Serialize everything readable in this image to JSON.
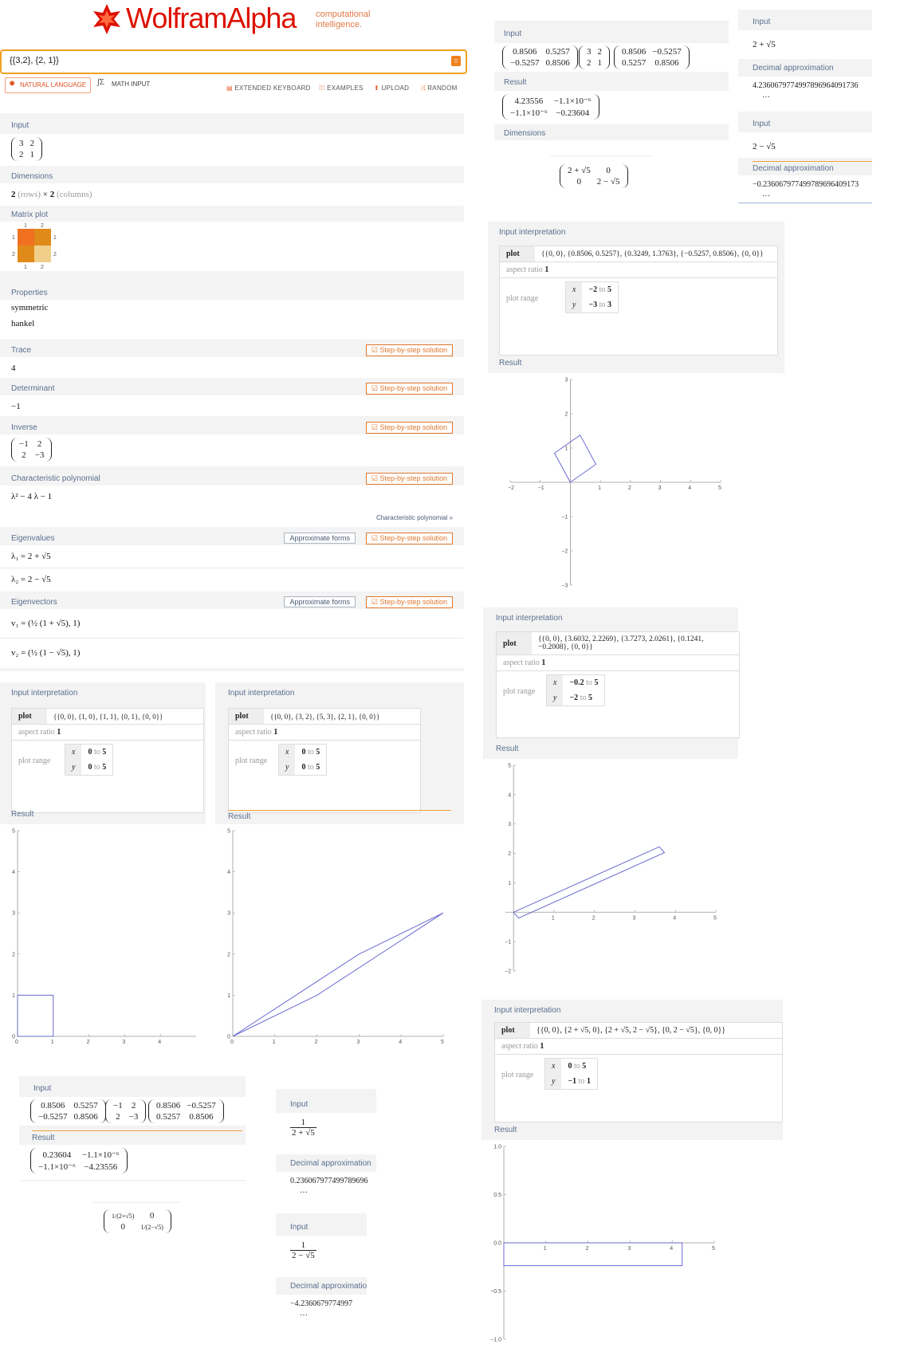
{
  "header": {
    "logo_word": "WolframAlpha",
    "tagline_1": "computational",
    "tagline_2": "intelligence.",
    "query": "{{3,2}, {2, 1}}",
    "natural_language": "NATURAL LANGUAGE",
    "math_input": "MATH INPUT",
    "extended_keyboard": "EXTENDED KEYBOARD",
    "examples": "EXAMPLES",
    "upload": "UPLOAD",
    "random": "RANDOM"
  },
  "main": {
    "input_label": "Input",
    "matrix": [
      [
        "3",
        "2"
      ],
      [
        "2",
        "1"
      ]
    ],
    "dimensions_label": "Dimensions",
    "dimensions_rows": "2",
    "dimensions_rows_word": "(rows)",
    "dimensions_times": "×",
    "dimensions_cols": "2",
    "dimensions_cols_word": "(columns)",
    "matrix_plot_label": "Matrix plot",
    "matrix_plot_ticks": [
      "1",
      "2"
    ],
    "properties_label": "Properties",
    "properties": [
      "symmetric",
      "hankel"
    ],
    "trace_label": "Trace",
    "trace": "4",
    "determinant_label": "Determinant",
    "determinant": "−1",
    "inverse_label": "Inverse",
    "inverse": [
      [
        "−1",
        "2"
      ],
      [
        "2",
        "−3"
      ]
    ],
    "char_poly_label": "Characteristic polynomial",
    "char_poly": "λ² − 4 λ − 1",
    "char_poly_link": "Characteristic polynomial »",
    "eigenvalues_label": "Eigenvalues",
    "eigenvalue_1": "λ₁ = 2 + √5",
    "eigenvalue_2": "λ₂ = 2 − √5",
    "eigenvectors_label": "Eigenvectors",
    "eigenvector_1": "v₁ = (½ (1 + √5), 1)",
    "eigenvector_2": "v₂ = (½ (1 − √5), 1)",
    "step_by_step": "Step-by-step solution",
    "approximate_forms": "Approximate forms"
  },
  "diag_panel": {
    "input_label": "Input",
    "m1": [
      [
        "0.8506",
        "0.5257"
      ],
      [
        "−0.5257",
        "0.8506"
      ]
    ],
    "m2": [
      [
        "3",
        "2"
      ],
      [
        "2",
        "1"
      ]
    ],
    "m3": [
      [
        "0.8506",
        "−0.5257"
      ],
      [
        "0.5257",
        "0.8506"
      ]
    ],
    "result_label": "Result",
    "result": [
      [
        "4.23556",
        "−1.1×10⁻⁶"
      ],
      [
        "−1.1×10⁻⁶",
        "−0.23604"
      ]
    ],
    "dimensions_label": "Dimensions",
    "diag": [
      [
        "2 + √5",
        "0"
      ],
      [
        "0",
        "2 − √5"
      ]
    ]
  },
  "eig_values_panel": {
    "input_label": "Input",
    "input_1": "2 + √5",
    "decimal_label": "Decimal approximation",
    "decimal_1": "4.2360679774997896964091736",
    "input_2": "2 − √5",
    "decimal_2": "−0.236067977499789696409173",
    "ellipsis": "…"
  },
  "plots": {
    "input_interpretation": "Input interpretation",
    "plot_word": "plot",
    "aspect_ratio_word": "aspect ratio",
    "aspect_ratio_value": "1",
    "plot_range_word": "plot range",
    "to_word": "to",
    "result_label": "Result",
    "p1": {
      "points": "{{0, 0}, {0.8506, 0.5257}, {0.3249, 1.3763}, {−0.5257, 0.8506}, {0, 0}}",
      "xmin": "−2",
      "xmax": "5",
      "ymin": "−3",
      "ymax": "3"
    },
    "p2": {
      "points": "{{0, 0}, {3.6032, 2.2269}, {3.7273, 2.0261}, {0.1241, −0.2008}, {0, 0}}",
      "xmin": "−0.2",
      "xmax": "5",
      "ymin": "−2",
      "ymax": "5"
    },
    "p3": {
      "points": "{{0, 0}, {1, 0}, {1, 1}, {0, 1}, {0, 0}}",
      "xmin": "0",
      "xmax": "5",
      "ymin": "0",
      "ymax": "5"
    },
    "p4": {
      "points": "{{0, 0}, {3, 2}, {5, 3}, {2, 1}, {0, 0}}",
      "xmin": "0",
      "xmax": "5",
      "ymin": "0",
      "ymax": "5"
    },
    "p5": {
      "points": "{{0, 0}, {2 + √5, 0}, {2 + √5, 2 − √5}, {0, 2 − √5}, {0, 0}}",
      "xmin": "0",
      "xmax": "5",
      "ymin": "−1",
      "ymax": "1"
    }
  },
  "inv_panel": {
    "input_label": "Input",
    "m1": [
      [
        "0.8506",
        "0.5257"
      ],
      [
        "−0.5257",
        "0.8506"
      ]
    ],
    "m2": [
      [
        "−1",
        "2"
      ],
      [
        "2",
        "−3"
      ]
    ],
    "m3": [
      [
        "0.8506",
        "−0.5257"
      ],
      [
        "0.5257",
        "0.8506"
      ]
    ],
    "result_label": "Result",
    "result": [
      [
        "0.23604",
        "−1.1×10⁻⁶"
      ],
      [
        "−1.1×10⁻⁶",
        "−4.23556"
      ]
    ],
    "diag": [
      [
        "1/(2+√5)",
        "0"
      ],
      [
        "0",
        "1/(2−√5)"
      ]
    ]
  },
  "recip_panels": {
    "input_label": "Input",
    "decimal_label": "Decimal approximation",
    "r1_num": "1",
    "r1_den": "2 + √5",
    "r1_decimal": "0.236067977499789696",
    "r2_num": "1",
    "r2_den": "2 − √5",
    "r2_decimal": "−4.2360679774997",
    "ellipsis": "…"
  },
  "chart_data": [
    {
      "type": "line",
      "series": [
        {
          "x": [
            0,
            0.8506,
            0.3249,
            -0.5257,
            0
          ],
          "y": [
            0,
            0.5257,
            1.3763,
            0.8506,
            0
          ]
        }
      ],
      "xlim": [
        -2,
        5
      ],
      "ylim": [
        -3,
        3
      ],
      "xticks": [
        "−2",
        "−1",
        "1",
        "2",
        "3",
        "4",
        "5"
      ],
      "yticks": [
        "3",
        "2",
        "1",
        "−1",
        "−2",
        "−3"
      ]
    },
    {
      "type": "line",
      "series": [
        {
          "x": [
            0,
            3.6032,
            3.7273,
            0.1241,
            0
          ],
          "y": [
            0,
            2.2269,
            2.0261,
            -0.2008,
            0
          ]
        }
      ],
      "xlim": [
        -0.2,
        5
      ],
      "ylim": [
        -2,
        5
      ],
      "xticks": [
        "1",
        "2",
        "3",
        "4",
        "5"
      ],
      "yticks": [
        "5",
        "4",
        "3",
        "2",
        "1",
        "−1",
        "−2"
      ]
    },
    {
      "type": "line",
      "series": [
        {
          "x": [
            0,
            1,
            1,
            0,
            0
          ],
          "y": [
            0,
            0,
            1,
            1,
            0
          ]
        }
      ],
      "xlim": [
        0,
        5
      ],
      "ylim": [
        0,
        5
      ],
      "xticks": [
        "0",
        "1",
        "2",
        "3",
        "4"
      ],
      "yticks": [
        "5",
        "4",
        "3",
        "2",
        "1",
        "0"
      ]
    },
    {
      "type": "line",
      "series": [
        {
          "x": [
            0,
            3,
            5,
            2,
            0
          ],
          "y": [
            0,
            2,
            3,
            1,
            0
          ]
        }
      ],
      "xlim": [
        0,
        5
      ],
      "ylim": [
        0,
        5
      ],
      "xticks": [
        "0",
        "1",
        "2",
        "3",
        "4",
        "5"
      ],
      "yticks": [
        "5",
        "4",
        "3",
        "2",
        "1",
        "0"
      ]
    },
    {
      "type": "line",
      "series": [
        {
          "x": [
            0,
            4.236,
            4.236,
            0,
            0
          ],
          "y": [
            0,
            0,
            -0.236,
            -0.236,
            0
          ]
        }
      ],
      "xlim": [
        0,
        5
      ],
      "ylim": [
        -1,
        1
      ],
      "xticks": [
        "1",
        "2",
        "3",
        "4",
        "5"
      ],
      "yticks": [
        "1.0",
        "0.5",
        "0.0",
        "−0.5",
        "−1.0"
      ]
    }
  ]
}
